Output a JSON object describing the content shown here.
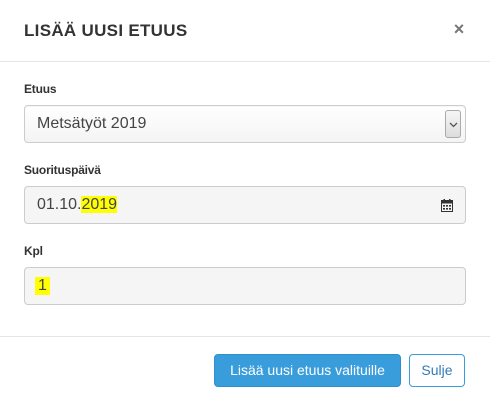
{
  "dialog": {
    "title": "LISÄÄ UUSI ETUUS",
    "close_glyph": "×"
  },
  "form": {
    "etuus": {
      "label": "Etuus",
      "selected": "Metsätyöt 2019"
    },
    "suorituspaiva": {
      "label": "Suorituspäivä",
      "value_prefix": "01.10.",
      "value_highlight": "2019",
      "icon": "calendar-icon"
    },
    "kpl": {
      "label": "Kpl",
      "value": "1"
    }
  },
  "footer": {
    "primary_label": "Lisää uusi etuus valituille",
    "close_label": "Sulje"
  },
  "colors": {
    "primary": "#3a9ddb",
    "highlight": "#ffff00",
    "input_bg": "#f5f5f5"
  }
}
